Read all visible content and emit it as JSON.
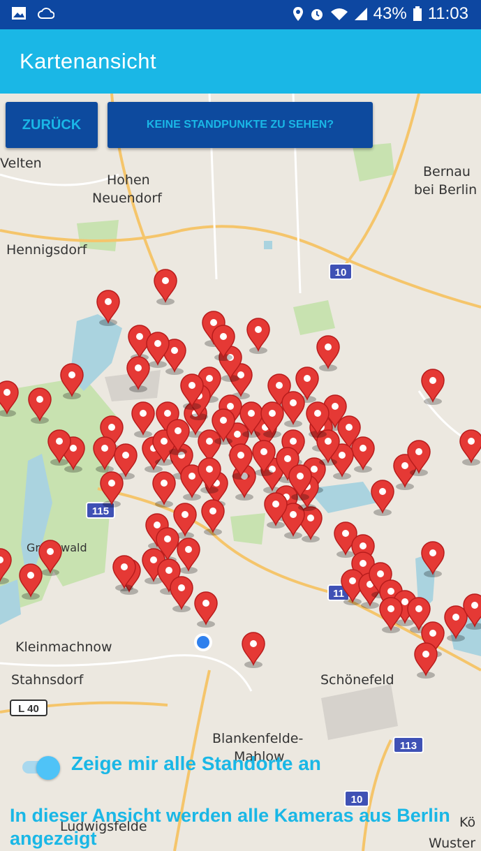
{
  "status_bar": {
    "icons_left": [
      "image-icon",
      "cloud-sync-icon"
    ],
    "icons_right": [
      "location-icon",
      "alarm-icon",
      "wifi-icon",
      "signal-icon",
      "battery-icon"
    ],
    "battery": "43%",
    "time": "11:03"
  },
  "app_bar": {
    "title": "Kartenansicht"
  },
  "buttons": {
    "back": "ZURÜCK",
    "no_locations": "KEINE STANDPUNKTE ZU SEHEN?"
  },
  "map": {
    "place_labels": [
      "Velten",
      "Hohen",
      "Neuendorf",
      "Bernau",
      "bei Berlin",
      "Hennigsdorf",
      "Grunewald",
      "Kleinmachnow",
      "Stahnsdorf",
      "Schönefeld",
      "Blankenfelde-",
      "Mahlow",
      "Ludwigsfelde",
      "Kö",
      "Wuster"
    ],
    "road_shields": [
      "10",
      "115",
      "11",
      "L 40",
      "113",
      "10"
    ]
  },
  "toggle": {
    "label": "Zeige mir alle Standorte an"
  },
  "info_text": "In dieser Ansicht werden alle Kameras aus Berlin angezeigt",
  "colors": {
    "status_bar": "#0d47a1",
    "app_bar": "#1ab7e6",
    "button_bg": "#0d4a9e",
    "marker": "#e53935"
  }
}
